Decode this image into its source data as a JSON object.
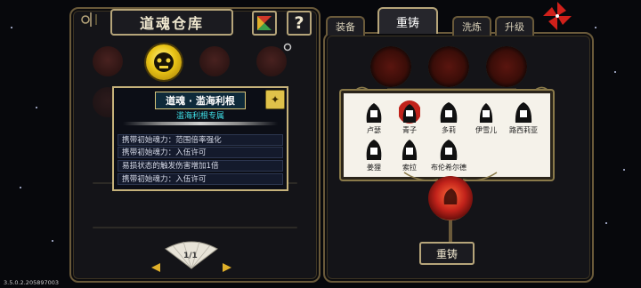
{
  "warehouse": {
    "title": "道魂仓库",
    "help_label": "?",
    "page_indicator": "1/1"
  },
  "tooltip": {
    "title": "道魂 · 滥海利根",
    "subtitle": "滥海利根专属",
    "lines": [
      "携带初始魂力：范围倍率强化",
      "携带初始魂力：入伍许可",
      "易损状态的触发伤害增加1倍",
      "携带初始魂力：入伍许可"
    ]
  },
  "tabs": [
    {
      "label": "装备",
      "active": false
    },
    {
      "label": "重铸",
      "active": true
    },
    {
      "label": "洗炼",
      "active": false
    },
    {
      "label": "升级",
      "active": false
    }
  ],
  "characters": [
    {
      "name": "卢瑟",
      "selected": false
    },
    {
      "name": "青子",
      "selected": true
    },
    {
      "name": "多莉",
      "selected": false
    },
    {
      "name": "伊雪儿",
      "selected": false
    },
    {
      "name": "路西莉亚",
      "selected": false
    },
    {
      "name": "姜狸",
      "selected": false
    },
    {
      "name": "索拉",
      "selected": false
    },
    {
      "name": "布伦希尔德",
      "selected": false
    }
  ],
  "reforge_button": "重铸",
  "version": "3.5.0.2.205897003",
  "colors": {
    "gold_border": "#b6a57a",
    "tooltip_title_bg": "#0e2a3a",
    "subtitle_cyan": "#3fe0e8",
    "socket_red": "#c1221a"
  }
}
